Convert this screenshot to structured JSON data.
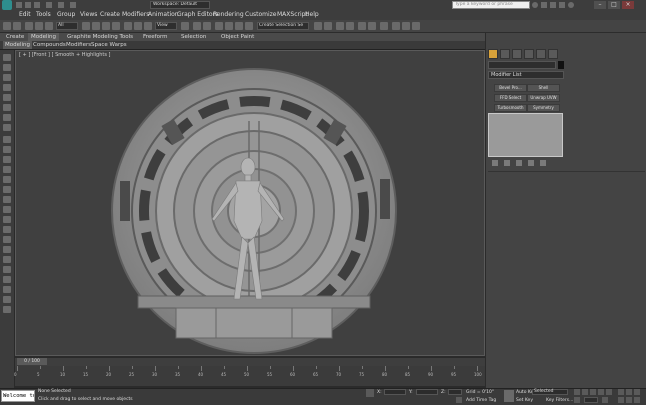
{
  "titlebar": {
    "workspace_label": "Workspace: Default",
    "search_placeholder": "Type a keyword or phrase"
  },
  "menubar": {
    "items": [
      "Edit",
      "Tools",
      "Group",
      "Views",
      "Create",
      "Modifiers",
      "Animation",
      "Graph Editors",
      "Rendering",
      "Customize",
      "MAXScript",
      "Help"
    ]
  },
  "toolbar": {
    "selection_filter": "All",
    "view_dropdown": "View",
    "named_selection": "Create Selection Se"
  },
  "ribbon": {
    "tabs": [
      "Graphite Modeling Tools",
      "Freeform",
      "Selection",
      "Object Paint"
    ],
    "sub_tabs": [
      "Modeling",
      "Compounds",
      "Modifiers",
      "Space Warps"
    ],
    "left_tabs": [
      "Create",
      "Modeling"
    ]
  },
  "viewport": {
    "label": "[ + ] [Front ] [ Smooth + Highlights ]"
  },
  "command_panel": {
    "modifier_list": "Modifier List",
    "buttons": [
      "Bevel Pro...",
      "Shell",
      "FFD Select",
      "Unwrap UVW",
      "Turbosmooth",
      "Symmetry"
    ]
  },
  "timeline": {
    "frame_readout": "0 / 100",
    "ticks": [
      "0",
      "5",
      "10",
      "15",
      "20",
      "25",
      "30",
      "35",
      "40",
      "45",
      "50",
      "55",
      "60",
      "65",
      "70",
      "75",
      "80",
      "85",
      "90",
      "95",
      "100"
    ]
  },
  "statusbar": {
    "maxscript_text": "Welcome to MA",
    "status_line1": "None Selected",
    "status_line2": "Click and drag to select and move objects",
    "grid_label": "Grid = 0'10\"",
    "addtimetag_label": "Add Time Tag",
    "autokey_label": "Auto Key",
    "setkey_label": "Set Key",
    "selected_label": "Selected",
    "keyfilters_label": "Key Filters...",
    "x_label": "X:",
    "y_label": "Y:",
    "z_label": "Z:"
  },
  "colors": {
    "viewport_bg": "#404040",
    "panel_bg": "#444444",
    "model_gray": "#9a9a9a"
  }
}
